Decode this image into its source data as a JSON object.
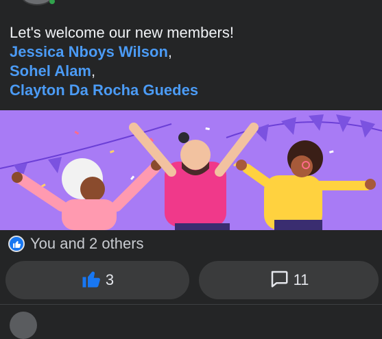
{
  "post": {
    "intro": "Let's welcome our new members!",
    "mentions": [
      {
        "name": "Jessica Nboys Wilson",
        "suffix": ","
      },
      {
        "name": "Sohel Alam",
        "suffix": ","
      },
      {
        "name": "Clayton Da Rocha Guedes",
        "suffix": ""
      }
    ]
  },
  "reactions": {
    "summary": "You and 2 others",
    "icon": "thumbs-up-icon"
  },
  "actions": {
    "like_count": "3",
    "comment_count": "11"
  },
  "colors": {
    "background": "#242526",
    "mention": "#4b9bf5",
    "banner": "#a87bf5",
    "button": "#3a3b3c",
    "like_blue": "#1877f2"
  }
}
